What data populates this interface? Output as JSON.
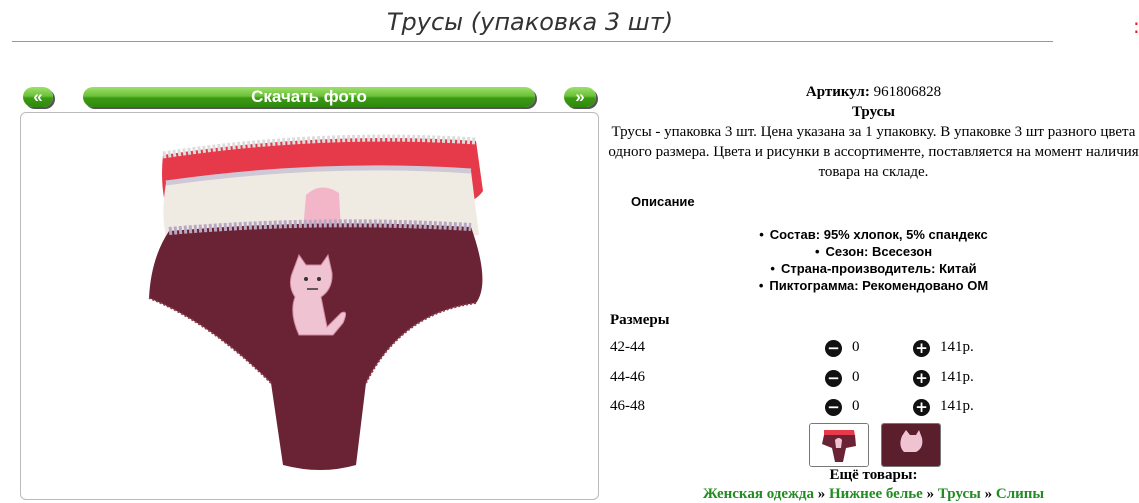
{
  "page": {
    "title": "Трусы (упаковка 3 шт)",
    "corner_mark": ":"
  },
  "gallery": {
    "prev_label": "«",
    "download_label": "Скачать фото",
    "next_label": "»"
  },
  "product": {
    "sku_label": "Артикул:",
    "sku_value": "961806828",
    "name": "Трусы",
    "description": "Трусы - упаковка 3 шт. Цена указана за 1 упаковку. В упаковке 3 шт разного цвета одного размера. Цвета и рисунки в ассортименте, поставляется на момент наличия товара на складе."
  },
  "description_section": {
    "title": "Описание",
    "properties": [
      "Состав: 95% хлопок, 5% спандекс",
      "Сезон: Всесезон",
      "Страна-производитель: Китай",
      "Пиктограмма: Рекомендовано ОМ"
    ]
  },
  "sizes": {
    "title": "Размеры",
    "rows": [
      {
        "size": "42-44",
        "qty": "0",
        "price": "141р."
      },
      {
        "size": "44-46",
        "qty": "0",
        "price": "141р."
      },
      {
        "size": "46-48",
        "qty": "0",
        "price": "141р."
      }
    ]
  },
  "more": {
    "label": "Ещё товары:",
    "breadcrumbs": [
      "Женская одежда",
      "Нижнее белье",
      "Трусы",
      "Слипы"
    ],
    "separator": "»"
  },
  "colors": {
    "accent_green": "#4caf1e",
    "link_green": "#228b22"
  }
}
